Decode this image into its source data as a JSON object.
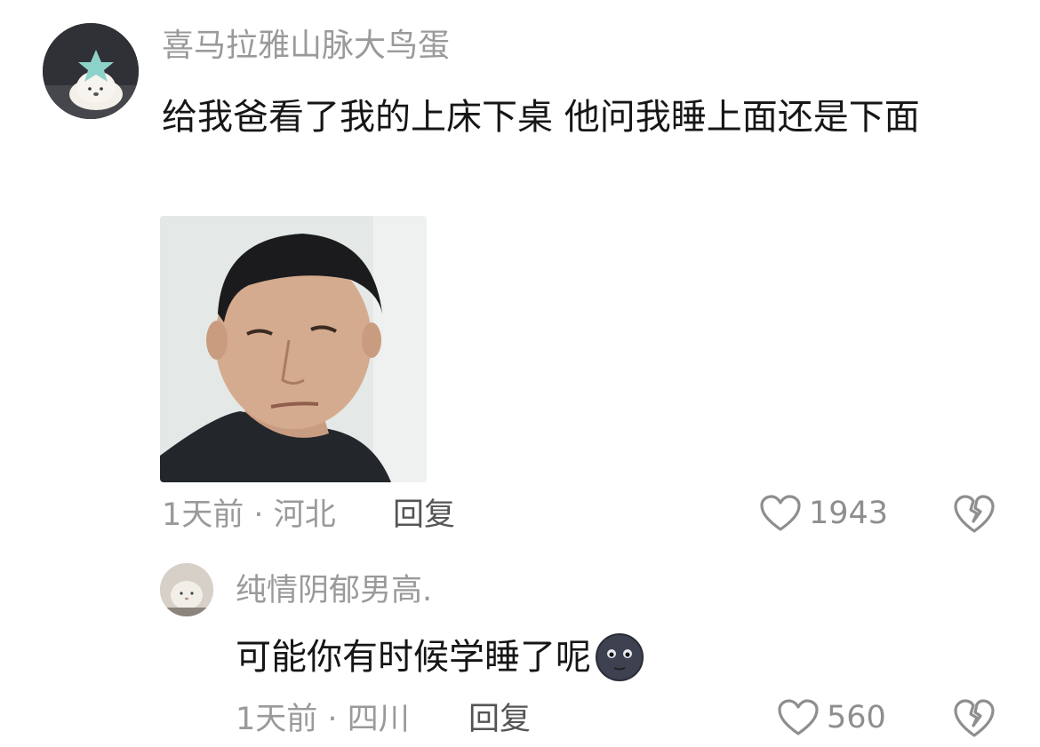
{
  "comment": {
    "username": "喜马拉雅山脉大鸟蛋",
    "text": "给我爸看了我的上床下桌 他问我睡上面还是下面",
    "image_icon": "meme-photo",
    "time": "1天前",
    "separator": "·",
    "location": "河北",
    "reply_label": "回复",
    "like_icon": "heart-outline-icon",
    "likes": "1943",
    "dislike_icon": "broken-heart-icon"
  },
  "reply": {
    "username": "纯情阴郁男高.",
    "text": "可能你有时候学睡了呢",
    "emoji": "new-moon-face-icon",
    "time": "1天前",
    "separator": "·",
    "location": "四川",
    "reply_label": "回复",
    "like_icon": "heart-outline-icon",
    "likes": "560",
    "dislike_icon": "broken-heart-icon"
  },
  "colors": {
    "username": "#9a9a9a",
    "text": "#161616",
    "meta": "#9a9a9a",
    "icon": "#8e8e8e"
  }
}
